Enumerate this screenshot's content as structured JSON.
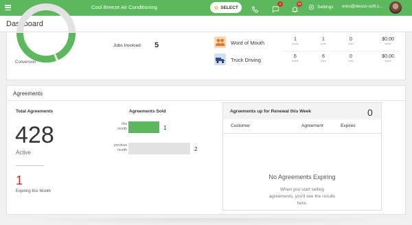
{
  "topbar": {
    "app_title": "Cool Breeze Air Conditioning",
    "select_label": "SELECT",
    "messages_badge": "1",
    "notifications_badge": "23",
    "settings_label": "Settings",
    "user_email": "ericr@desco-soft.c..."
  },
  "header": {
    "title": "Dashboard"
  },
  "summary": {
    "conversion_label": "Conversion",
    "jobs_invoiced_label": "Jobs Invoiced",
    "jobs_invoiced_value": "5"
  },
  "lead_sources": [
    {
      "name": "Word of Mouth",
      "leads": "1",
      "leads_unit": "leads",
      "jobs": "1",
      "jobs_unit": "jobs",
      "sold": "0",
      "sold_unit": "sold",
      "sales": "$0.00",
      "sales_unit": "sales"
    },
    {
      "name": "Truck Driving",
      "leads": "6",
      "leads_unit": "leads",
      "jobs": "6",
      "jobs_unit": "jobs",
      "sold": "0",
      "sold_unit": "sold",
      "sales": "$0.00",
      "sales_unit": "sales"
    }
  ],
  "agreements": {
    "section_title": "Agreements",
    "total_label": "Total Agreements",
    "total_value": "428",
    "active_label": "Active",
    "expiring_value": "1",
    "expiring_label": "Expiring this Month",
    "sold_title": "Agreements Sold",
    "sold_bars": [
      {
        "label_line1": "this",
        "label_line2": "month",
        "value": 1,
        "display": "1",
        "color": "#5cb85c"
      },
      {
        "label_line1": "previous",
        "label_line2": "month",
        "value": 2,
        "display": "2",
        "color": "#e2e2e2"
      }
    ],
    "renewal": {
      "title": "Agreements up for Renewal this Week",
      "count": "0",
      "columns": [
        "Customer",
        "Agreement",
        "Expires"
      ],
      "empty_title": "No Agreements Expiring",
      "empty_text": "When you start selling agreements, you'll see the results here."
    }
  },
  "colors": {
    "brand_green": "#5cb85c",
    "alert_red": "#d12d2d"
  }
}
